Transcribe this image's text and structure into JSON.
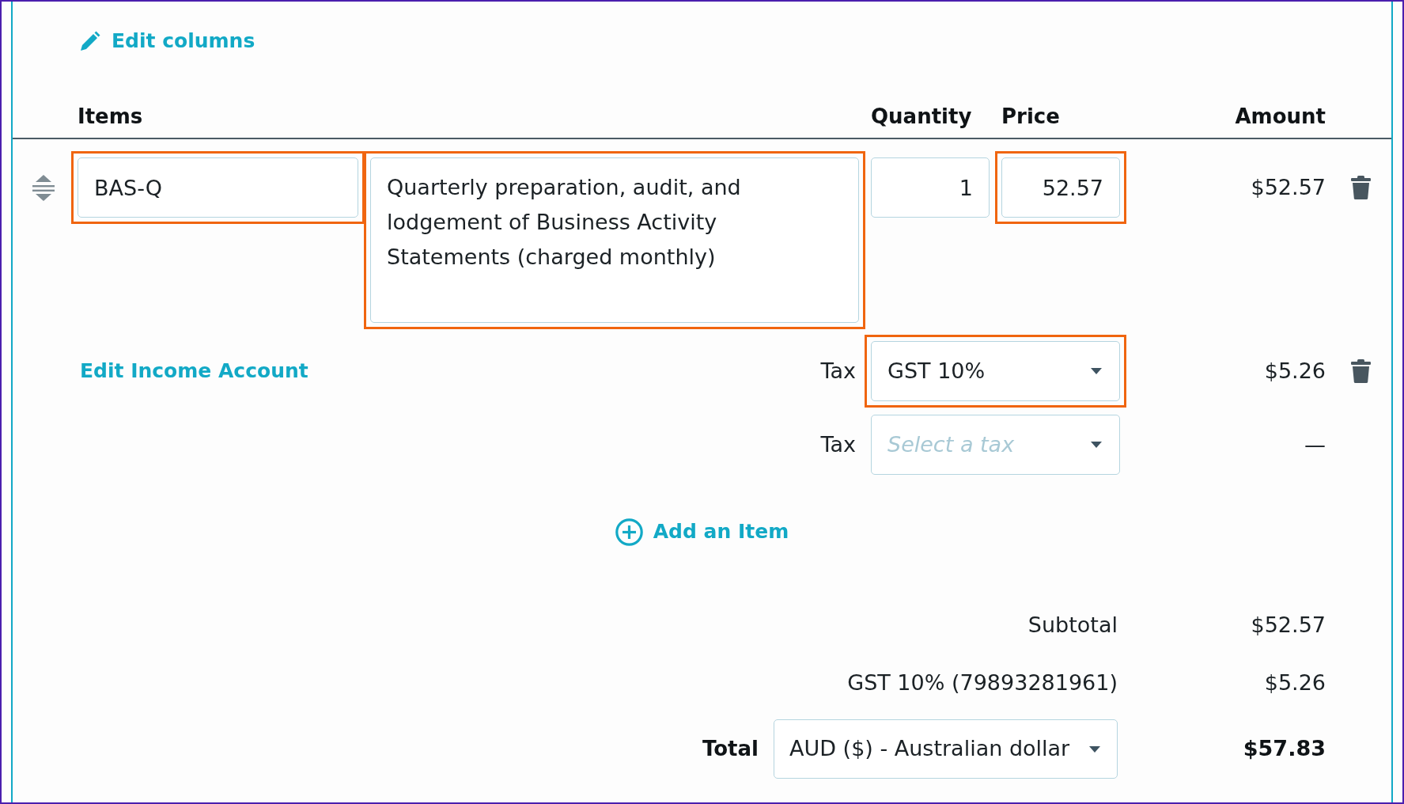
{
  "edit_columns": {
    "label": "Edit columns"
  },
  "table": {
    "columns": [
      {
        "kind": "item",
        "label": "Items"
      },
      {
        "kind": "quantity",
        "label": "Quantity"
      },
      {
        "kind": "price",
        "label": "Price"
      },
      {
        "kind": "amount",
        "label": "Amount"
      }
    ],
    "rows": [
      {
        "item": {
          "value": "BAS-Q",
          "highlighted": true
        },
        "description": {
          "value": "Quarterly preparation, audit, and lodgement of Business Activity Statements (charged monthly)",
          "highlighted": true
        },
        "quantity": {
          "value": "1",
          "highlighted": false
        },
        "price": {
          "value": "52.57",
          "highlighted": true
        },
        "amount": "$52.57",
        "income_account": {
          "label": "Edit Income Account"
        },
        "taxes": [
          {
            "label": "Tax",
            "value": "GST 10%",
            "highlighted": true,
            "amount": "$5.26",
            "deletable": true
          },
          {
            "label": "Tax",
            "placeholder": "Select a tax",
            "highlighted": false,
            "amount": "—",
            "deletable": false
          }
        ]
      }
    ]
  },
  "add_item": {
    "label": "Add an Item"
  },
  "summary": {
    "rows": [
      {
        "label": "Subtotal",
        "value": "$52.57"
      },
      {
        "label": "GST 10% (79893281961)",
        "value": "$5.26"
      }
    ],
    "total": {
      "label": "Total",
      "currency": "AUD ($) - Australian dollar",
      "value": "$57.83"
    }
  }
}
